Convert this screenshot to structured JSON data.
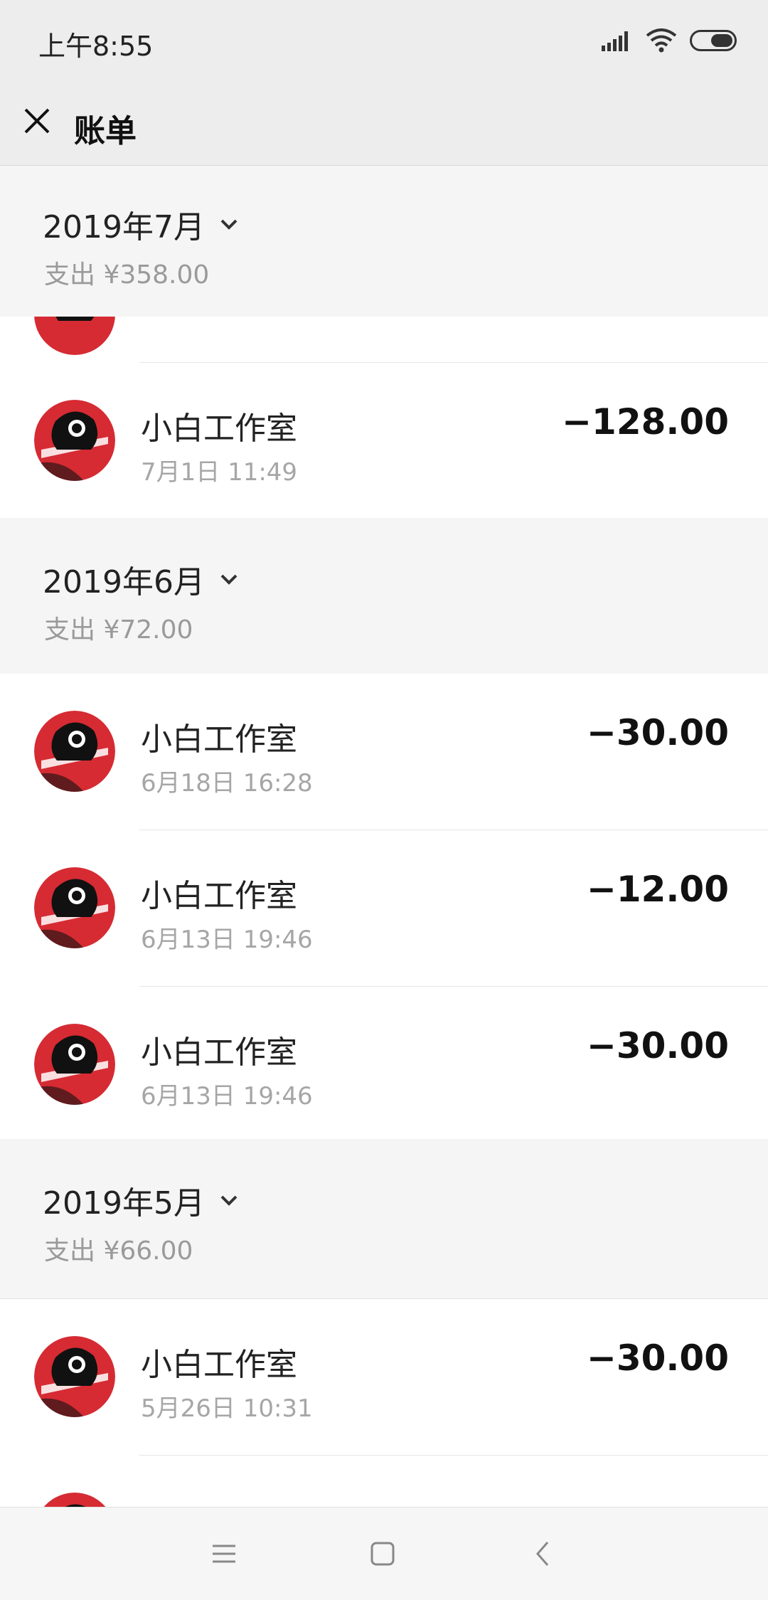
{
  "status": {
    "time": "上午8:55",
    "icons": [
      "signal-icon",
      "wifi-icon",
      "battery-icon"
    ]
  },
  "header": {
    "title": "账单",
    "close_icon": "close-icon"
  },
  "months": [
    {
      "title": "2019年7月",
      "summary": "支出 ¥358.00",
      "items": [
        {
          "merchant": "小白工作室",
          "time": "7月1日 11:49",
          "amount": "−128.00"
        }
      ]
    },
    {
      "title": "2019年6月",
      "summary": "支出 ¥72.00",
      "items": [
        {
          "merchant": "小白工作室",
          "time": "6月18日 16:28",
          "amount": "−30.00"
        },
        {
          "merchant": "小白工作室",
          "time": "6月13日 19:46",
          "amount": "−12.00"
        },
        {
          "merchant": "小白工作室",
          "time": "6月13日 19:46",
          "amount": "−30.00"
        }
      ]
    },
    {
      "title": "2019年5月",
      "summary": "支出 ¥66.00",
      "items": [
        {
          "merchant": "小白工作室",
          "time": "5月26日 10:31",
          "amount": "−30.00"
        }
      ]
    }
  ],
  "colors": {
    "background": "#ededed",
    "month_header": "#f5f5f5",
    "avatar_red": "#d62b33",
    "amount": "#111111",
    "secondary_text": "#a6a6a6"
  },
  "navbar": {
    "icons": [
      "menu-icon",
      "home-square-icon",
      "back-icon"
    ]
  }
}
